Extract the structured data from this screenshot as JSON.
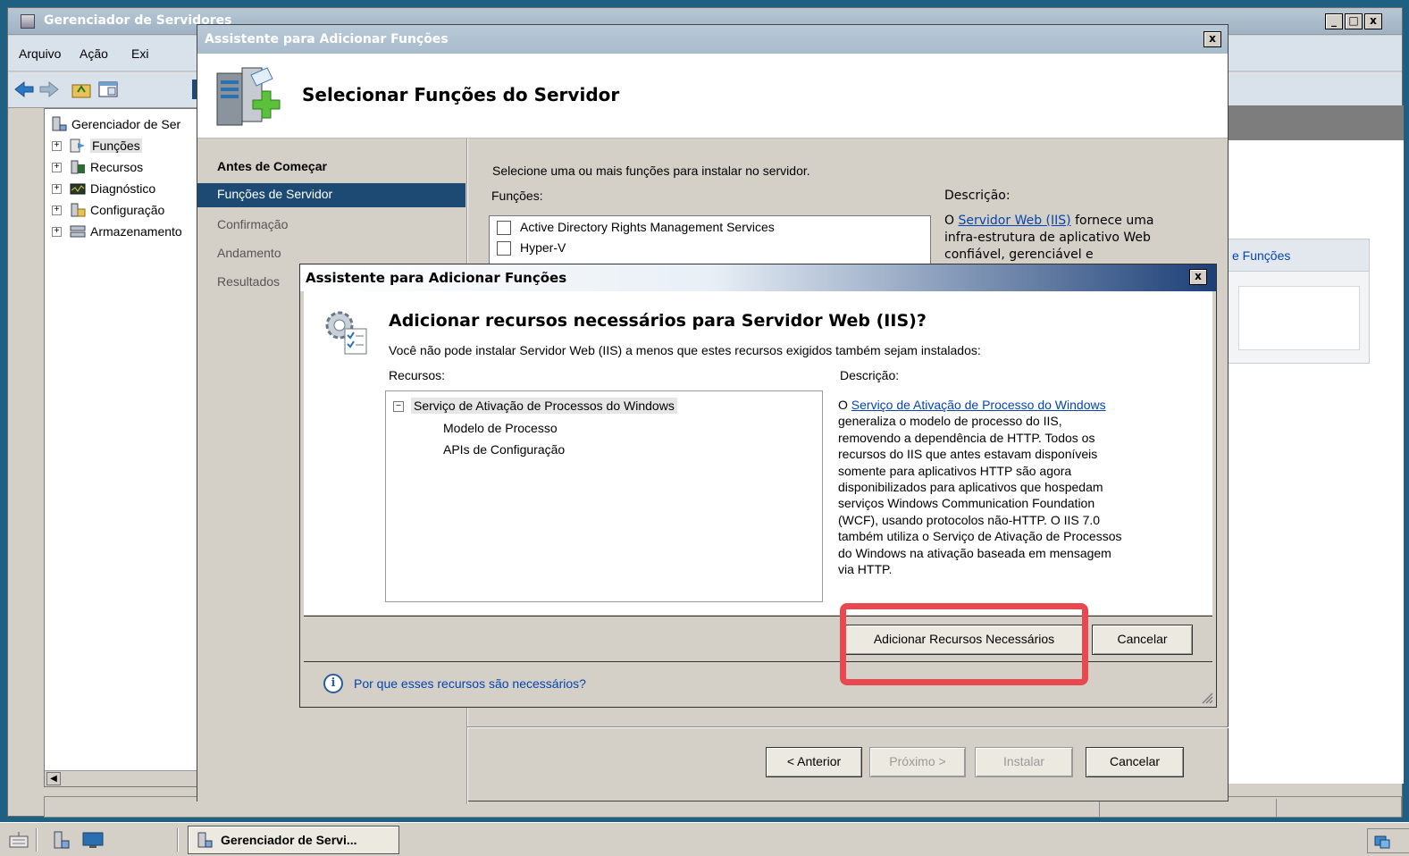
{
  "main_window": {
    "title": "Gerenciador de Servidores",
    "menu": [
      "Arquivo",
      "Ação",
      "Exi"
    ],
    "tree": {
      "root": "Gerenciador de Ser",
      "items": [
        "Funções",
        "Recursos",
        "Diagnóstico",
        "Configuração",
        "Armazenamento"
      ]
    },
    "right_panel_link": "e Funções",
    "controls": {
      "minimize": "_",
      "maximize": "□",
      "close": "x"
    }
  },
  "wizard": {
    "title": "Assistente para Adicionar Funções",
    "header_title": "Selecionar Funções do Servidor",
    "steps": [
      "Antes de Começar",
      "Funções de Servidor",
      "Confirmação",
      "Andamento",
      "Resultados"
    ],
    "selected_step": "Funções de Servidor",
    "instruction": "Selecione uma ou mais funções para instalar no servidor.",
    "roles_label": "Funções:",
    "roles": [
      "Active Directory Rights Management Services",
      "Hyper-V"
    ],
    "description_label": "Descrição:",
    "description_prefix": "O ",
    "description_link": "Servidor Web (IIS)",
    "description_suffix": " fornece uma",
    "description_line2": "infra-estrutura de aplicativo Web",
    "description_line3": "confiável, gerenciável e",
    "buttons": {
      "back": "< Anterior",
      "next": "Próximo >",
      "install": "Instalar",
      "cancel": "Cancelar"
    }
  },
  "dialog": {
    "title": "Assistente para Adicionar Funções",
    "heading": "Adicionar recursos necessários para Servidor Web (IIS)?",
    "subtitle": "Você não pode instalar Servidor Web (IIS) a menos que estes recursos exigidos também sejam instalados:",
    "features_label": "Recursos:",
    "description_label": "Descrição:",
    "features": {
      "parent": "Serviço de Ativação de Processos do Windows",
      "children": [
        "Modelo de Processo",
        "APIs de Configuração"
      ]
    },
    "description_prefix": "O ",
    "description_link": "Serviço de Ativação de Processo do Windows",
    "description_lines": [
      "generaliza o modelo de processo do IIS,",
      "removendo a dependência de HTTP. Todos os",
      "recursos do IIS que antes estavam disponíveis",
      "somente para aplicativos HTTP são agora",
      "disponibilizados para aplicativos que hospedam",
      "serviços Windows Communication Foundation",
      "(WCF), usando protocolos não-HTTP. O IIS 7.0",
      "também utiliza o Serviço de Ativação de Processos",
      "do Windows na ativação baseada em mensagem",
      "via HTTP."
    ],
    "buttons": {
      "add": "Adicionar Recursos Necessários",
      "cancel": "Cancelar"
    },
    "help_link": "Por que esses recursos são necessários?",
    "highlight_color": "#e8484f"
  },
  "taskbar": {
    "task_label": "Gerenciador de Servi..."
  }
}
